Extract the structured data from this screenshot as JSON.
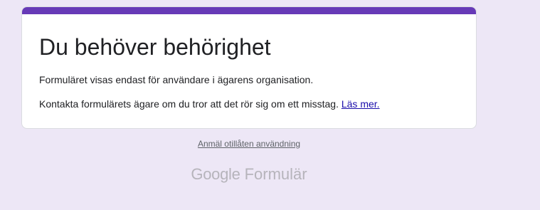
{
  "colors": {
    "page_background": "#ede7f6",
    "card_background": "#ffffff",
    "accent": "#673ab7",
    "text": "#202124",
    "link": "#1a0dab",
    "muted": "#5f6368",
    "logo": "#b6b4bb"
  },
  "card": {
    "title": "Du behöver behörighet",
    "message": "Formuläret visas endast för användare i ägarens organisation.",
    "contact_text": "Kontakta formulärets ägare om du tror att det rör sig om ett misstag.",
    "learn_more_link": "Läs mer."
  },
  "footer": {
    "report_abuse_link": "Anmäl otillåten användning",
    "brand_google": "Google",
    "brand_product": "Formulär"
  }
}
